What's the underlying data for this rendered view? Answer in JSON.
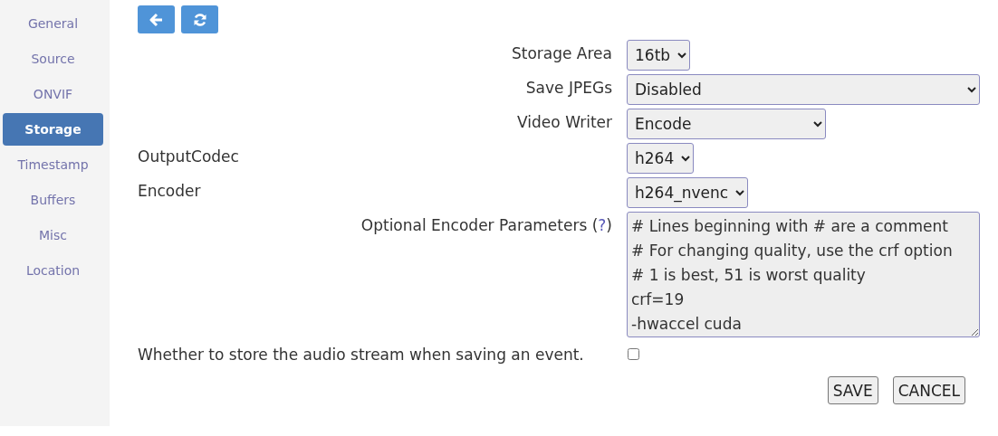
{
  "sidebar": {
    "items": [
      {
        "label": "General",
        "selected": false
      },
      {
        "label": "Source",
        "selected": false
      },
      {
        "label": "ONVIF",
        "selected": false
      },
      {
        "label": "Storage",
        "selected": true
      },
      {
        "label": "Timestamp",
        "selected": false
      },
      {
        "label": "Buffers",
        "selected": false
      },
      {
        "label": "Misc",
        "selected": false
      },
      {
        "label": "Location",
        "selected": false
      }
    ]
  },
  "toolbar": [
    {
      "kind": "back"
    },
    {
      "kind": "refresh"
    }
  ],
  "fields": [
    {
      "kind": "select",
      "label": "Storage Area",
      "value": "16tb"
    },
    {
      "kind": "select",
      "label": "Save JPEGs",
      "value": "Disabled"
    },
    {
      "kind": "select",
      "label": "Video Writer",
      "value": "Encode"
    },
    {
      "kind": "select",
      "label": "OutputCodec",
      "value": "h264"
    },
    {
      "kind": "select",
      "label": "Encoder",
      "value": "h264_nvenc"
    },
    {
      "kind": "textarea",
      "label": "Optional Encoder Parameters (",
      "help": "?",
      "label_end": ")",
      "value": "# Lines beginning with # are a comment\n# For changing quality, use the crf option\n# 1 is best, 51 is worst quality\ncrf=19\n-hwaccel cuda"
    },
    {
      "kind": "checkbox",
      "label": "Whether to store the audio stream when saving an event.",
      "checked": false
    }
  ],
  "buttons": [
    "SAVE",
    "CANCEL"
  ]
}
